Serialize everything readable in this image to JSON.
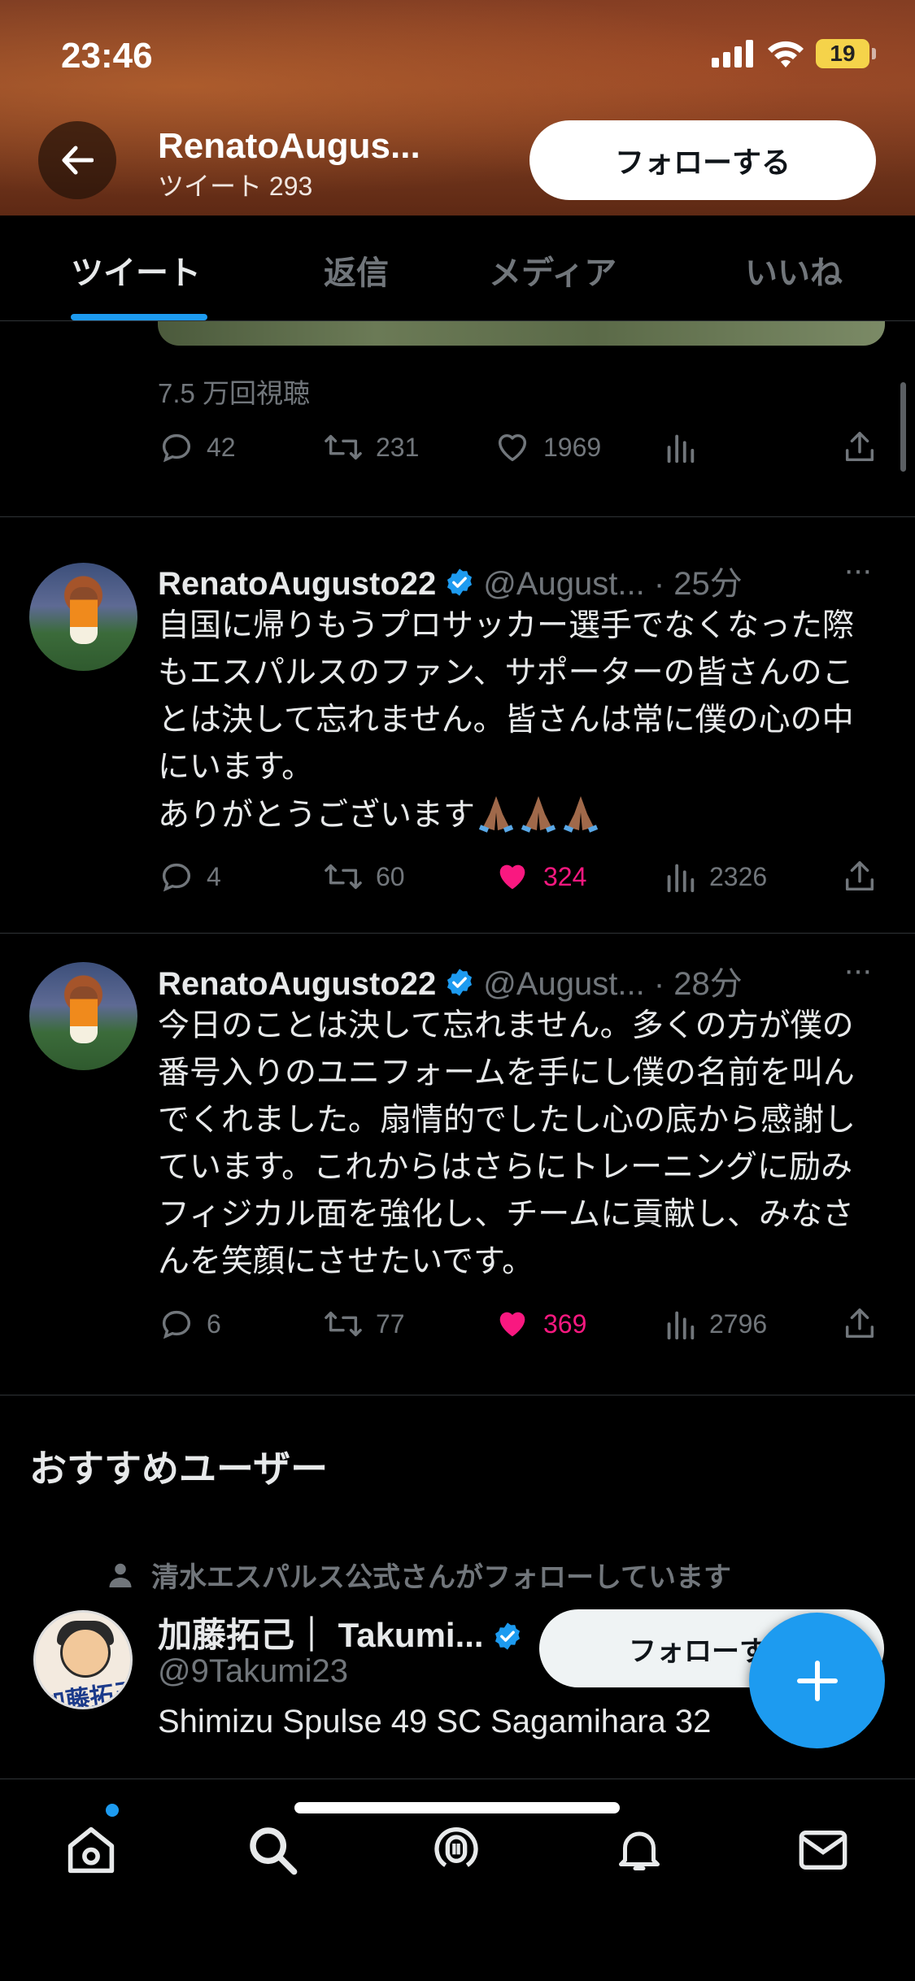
{
  "status_bar": {
    "time": "23:46",
    "battery": "19"
  },
  "header": {
    "profile_name": "RenatoAugus...",
    "tweet_count": "ツイート 293",
    "follow_label": "フォローする"
  },
  "tabs": [
    {
      "label": "ツイート",
      "active": true
    },
    {
      "label": "返信",
      "active": false
    },
    {
      "label": "メディア",
      "active": false
    },
    {
      "label": "いいね",
      "active": false
    }
  ],
  "partial_tweet": {
    "views": "7.5 万回視聴",
    "replies": "42",
    "retweets": "231",
    "likes": "1969"
  },
  "tweets": [
    {
      "name": "RenatoAugusto22",
      "handle_time": "@August... · 25分",
      "body": "自国に帰りもうプロサッカー選手でなくなった際もエスパルスのファン、サポーターの皆さんのことは決して忘れません。皆さんは常に僕の心の中にいます。\nありがとうございます",
      "emoji": "🙏🏾🙏🏾🙏🏾",
      "replies": "4",
      "retweets": "60",
      "likes": "324",
      "views": "2326",
      "liked": true
    },
    {
      "name": "RenatoAugusto22",
      "handle_time": "@August... · 28分",
      "body": "今日のことは決して忘れません。多くの方が僕の番号入りのユニフォームを手にし僕の名前を叫んでくれました。扇情的でしたし心の底から感謝しています。これからはさらにトレーニングに励みフィジカル面を強化し、チームに貢献し、みなさんを笑顔にさせたいです。",
      "replies": "6",
      "retweets": "77",
      "likes": "369",
      "views": "2796",
      "liked": true
    }
  ],
  "recommended": {
    "section_title": "おすすめユーザー",
    "followed_note": "清水エスパルス公式さんがフォローしています",
    "name": "加藤拓己｜ Takumi...",
    "handle": "@9Takumi23",
    "bio": "Shimizu Spulse 49 SC Sagamihara 32",
    "follow_label": "フォローする",
    "avatar_text": "加藤拓己"
  },
  "colors": {
    "accent": "#1d9bf0",
    "like": "#f91880",
    "muted": "#71767b"
  },
  "nav": [
    "home-icon",
    "search-icon",
    "spaces-icon",
    "notifications-icon",
    "messages-icon"
  ]
}
